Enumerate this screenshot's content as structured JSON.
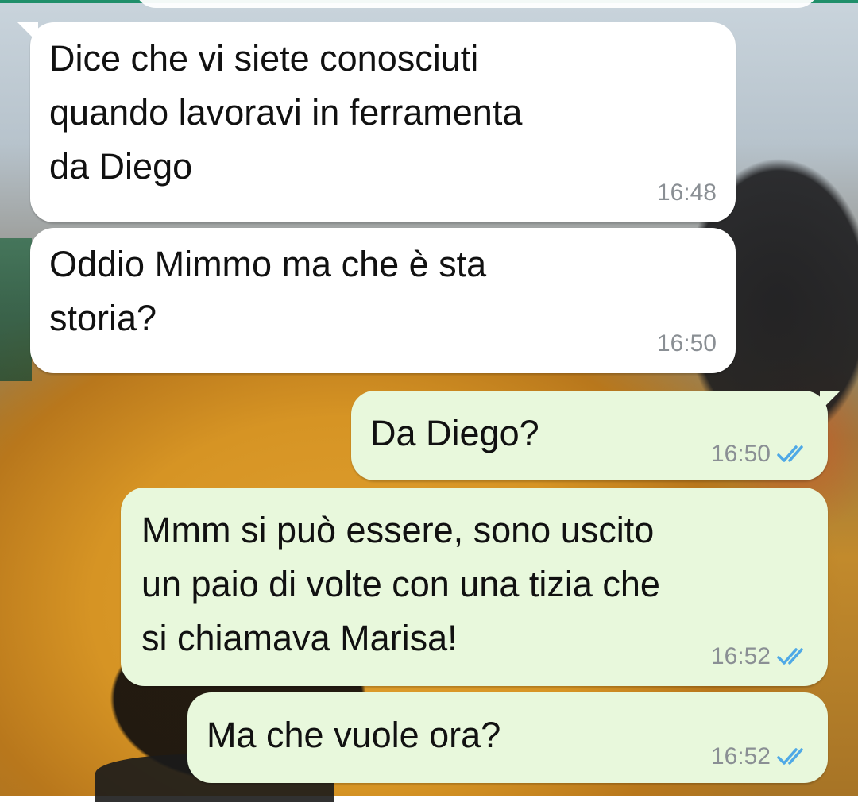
{
  "messages": [
    {
      "direction": "in",
      "text": "Dice che vi siete conosciuti\nquando lavoravi in ferramenta\nda Diego",
      "time": "16:48",
      "read": false
    },
    {
      "direction": "in",
      "text": "Oddio Mimmo ma che è sta\nstoria?",
      "time": "16:50",
      "read": false
    },
    {
      "direction": "out",
      "text": "Da Diego?",
      "time": "16:50",
      "read": true
    },
    {
      "direction": "out",
      "text": "Mmm si può essere, sono uscito\nun paio di volte con una tizia che\nsi chiamava Marisa!",
      "time": "16:52",
      "read": true
    },
    {
      "direction": "out",
      "text": "Ma che vuole ora?",
      "time": "16:52",
      "read": true
    }
  ],
  "colors": {
    "incoming_bubble": "#ffffff",
    "outgoing_bubble": "#e8f8dc",
    "read_ticks": "#4fa9e6",
    "timestamp": "#8a8f94"
  },
  "icons": {
    "read_receipt": "double-check-icon"
  }
}
